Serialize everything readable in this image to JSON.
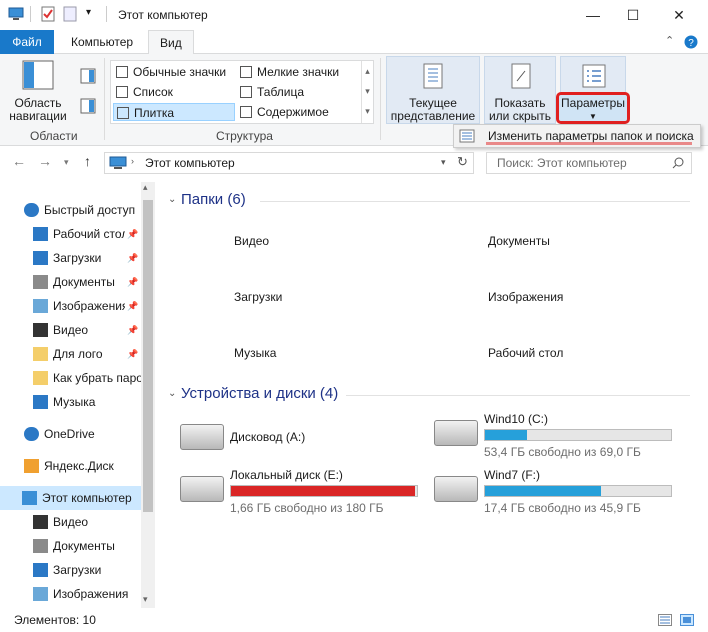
{
  "window": {
    "title": "Этот компьютер",
    "minimize": "—",
    "maximize": "☐",
    "close": "✕"
  },
  "ribbon_tabs": [
    {
      "label": "Файл"
    },
    {
      "label": "Компьютер"
    },
    {
      "label": "Вид"
    }
  ],
  "ribbon": {
    "areas_button": "Область навигации",
    "areas_group": "Области",
    "layout": {
      "items": [
        "Обычные значки",
        "Мелкие значки",
        "Список",
        "Таблица",
        "Плитка",
        "Содержимое"
      ],
      "selected": "Плитка"
    },
    "structure_group": "Структура",
    "current_view": "Текущее представление",
    "show_hide": "Показать или скрыть",
    "options": "Параметры",
    "change_options": "Изменить параметры папок и поиска",
    "highlight_color": "#e02020"
  },
  "address": {
    "path": "Этот компьютер",
    "search_placeholder": "Поиск: Этот компьютер"
  },
  "sidebar": {
    "items": [
      {
        "label": "Быстрый доступ",
        "icon": "star-icon",
        "pinned": false
      },
      {
        "label": "Рабочий стол",
        "icon": "desktop-icon",
        "pinned": true
      },
      {
        "label": "Загрузки",
        "icon": "download-icon",
        "pinned": true
      },
      {
        "label": "Документы",
        "icon": "documents-icon",
        "pinned": true
      },
      {
        "label": "Изображения",
        "icon": "pictures-icon",
        "pinned": true
      },
      {
        "label": "Видео",
        "icon": "video-icon",
        "pinned": true
      },
      {
        "label": "Для лого",
        "icon": "folder-icon",
        "pinned": true
      },
      {
        "label": "Как убрать паро",
        "icon": "folder-icon",
        "pinned": false
      },
      {
        "label": "Музыка",
        "icon": "music-icon",
        "pinned": false
      },
      {
        "label": "OneDrive",
        "icon": "cloud-icon",
        "pinned": false
      },
      {
        "label": "Яндекс.Диск",
        "icon": "yandex-disk-icon",
        "pinned": false
      },
      {
        "label": "Этот компьютер",
        "icon": "computer-icon",
        "pinned": false,
        "selected": true
      },
      {
        "label": "Видео",
        "icon": "video-icon",
        "pinned": false
      },
      {
        "label": "Документы",
        "icon": "documents-icon",
        "pinned": false
      },
      {
        "label": "Загрузки",
        "icon": "download-icon",
        "pinned": false
      },
      {
        "label": "Изображения",
        "icon": "pictures-icon",
        "pinned": false
      }
    ]
  },
  "folders_header": "Папки (6)",
  "folders": [
    {
      "label": "Видео",
      "icon": "video-folder-icon"
    },
    {
      "label": "Документы",
      "icon": "documents-folder-icon"
    },
    {
      "label": "Загрузки",
      "icon": "downloads-folder-icon"
    },
    {
      "label": "Изображения",
      "icon": "pictures-folder-icon"
    },
    {
      "label": "Музыка",
      "icon": "music-folder-icon"
    },
    {
      "label": "Рабочий стол",
      "icon": "desktop-folder-icon"
    }
  ],
  "drives_header": "Устройства и диски (4)",
  "drives": [
    {
      "name": "Дисковод (A:)",
      "icon": "floppy-drive-icon"
    },
    {
      "name": "Wind10 (C:)",
      "free": "53,4 ГБ свободно из 69,0 ГБ",
      "used_fraction": 0.226,
      "bar_color": "#26a0da",
      "icon": "windows-drive-icon"
    },
    {
      "name": "Локальный диск (E:)",
      "free": "1,66 ГБ свободно из 180 ГБ",
      "used_fraction": 0.991,
      "bar_color": "#da2626",
      "icon": "hdd-icon"
    },
    {
      "name": "Wind7 (F:)",
      "free": "17,4 ГБ свободно из 45,9 ГБ",
      "used_fraction": 0.621,
      "bar_color": "#26a0da",
      "icon": "hdd-icon"
    }
  ],
  "status": {
    "items_count": "Элементов: 10"
  }
}
